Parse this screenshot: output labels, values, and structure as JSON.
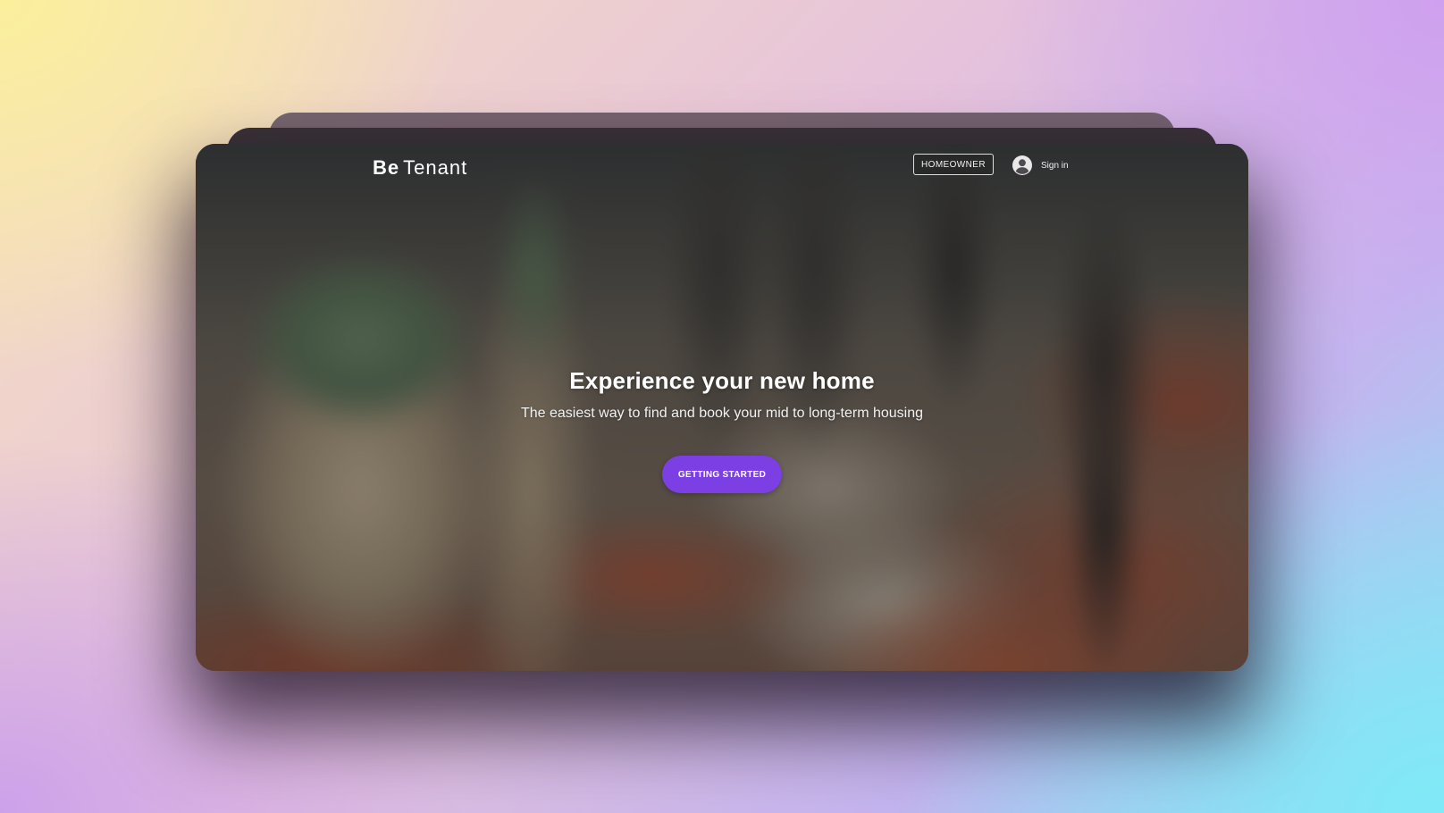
{
  "brand": {
    "logo_bold": "Be",
    "logo_regular": "Tenant"
  },
  "header": {
    "homeowner_label": "HOMEOWNER",
    "signin_label": "Sign in",
    "signin_icon": "account-circle-icon"
  },
  "hero": {
    "title": "Experience your new home",
    "subtitle": "The easiest way to find and book your mid to long-term housing",
    "cta_label": "GETTING STARTED"
  },
  "colors": {
    "accent": "#7b3fe4",
    "text_on_image": "#ffffff"
  }
}
